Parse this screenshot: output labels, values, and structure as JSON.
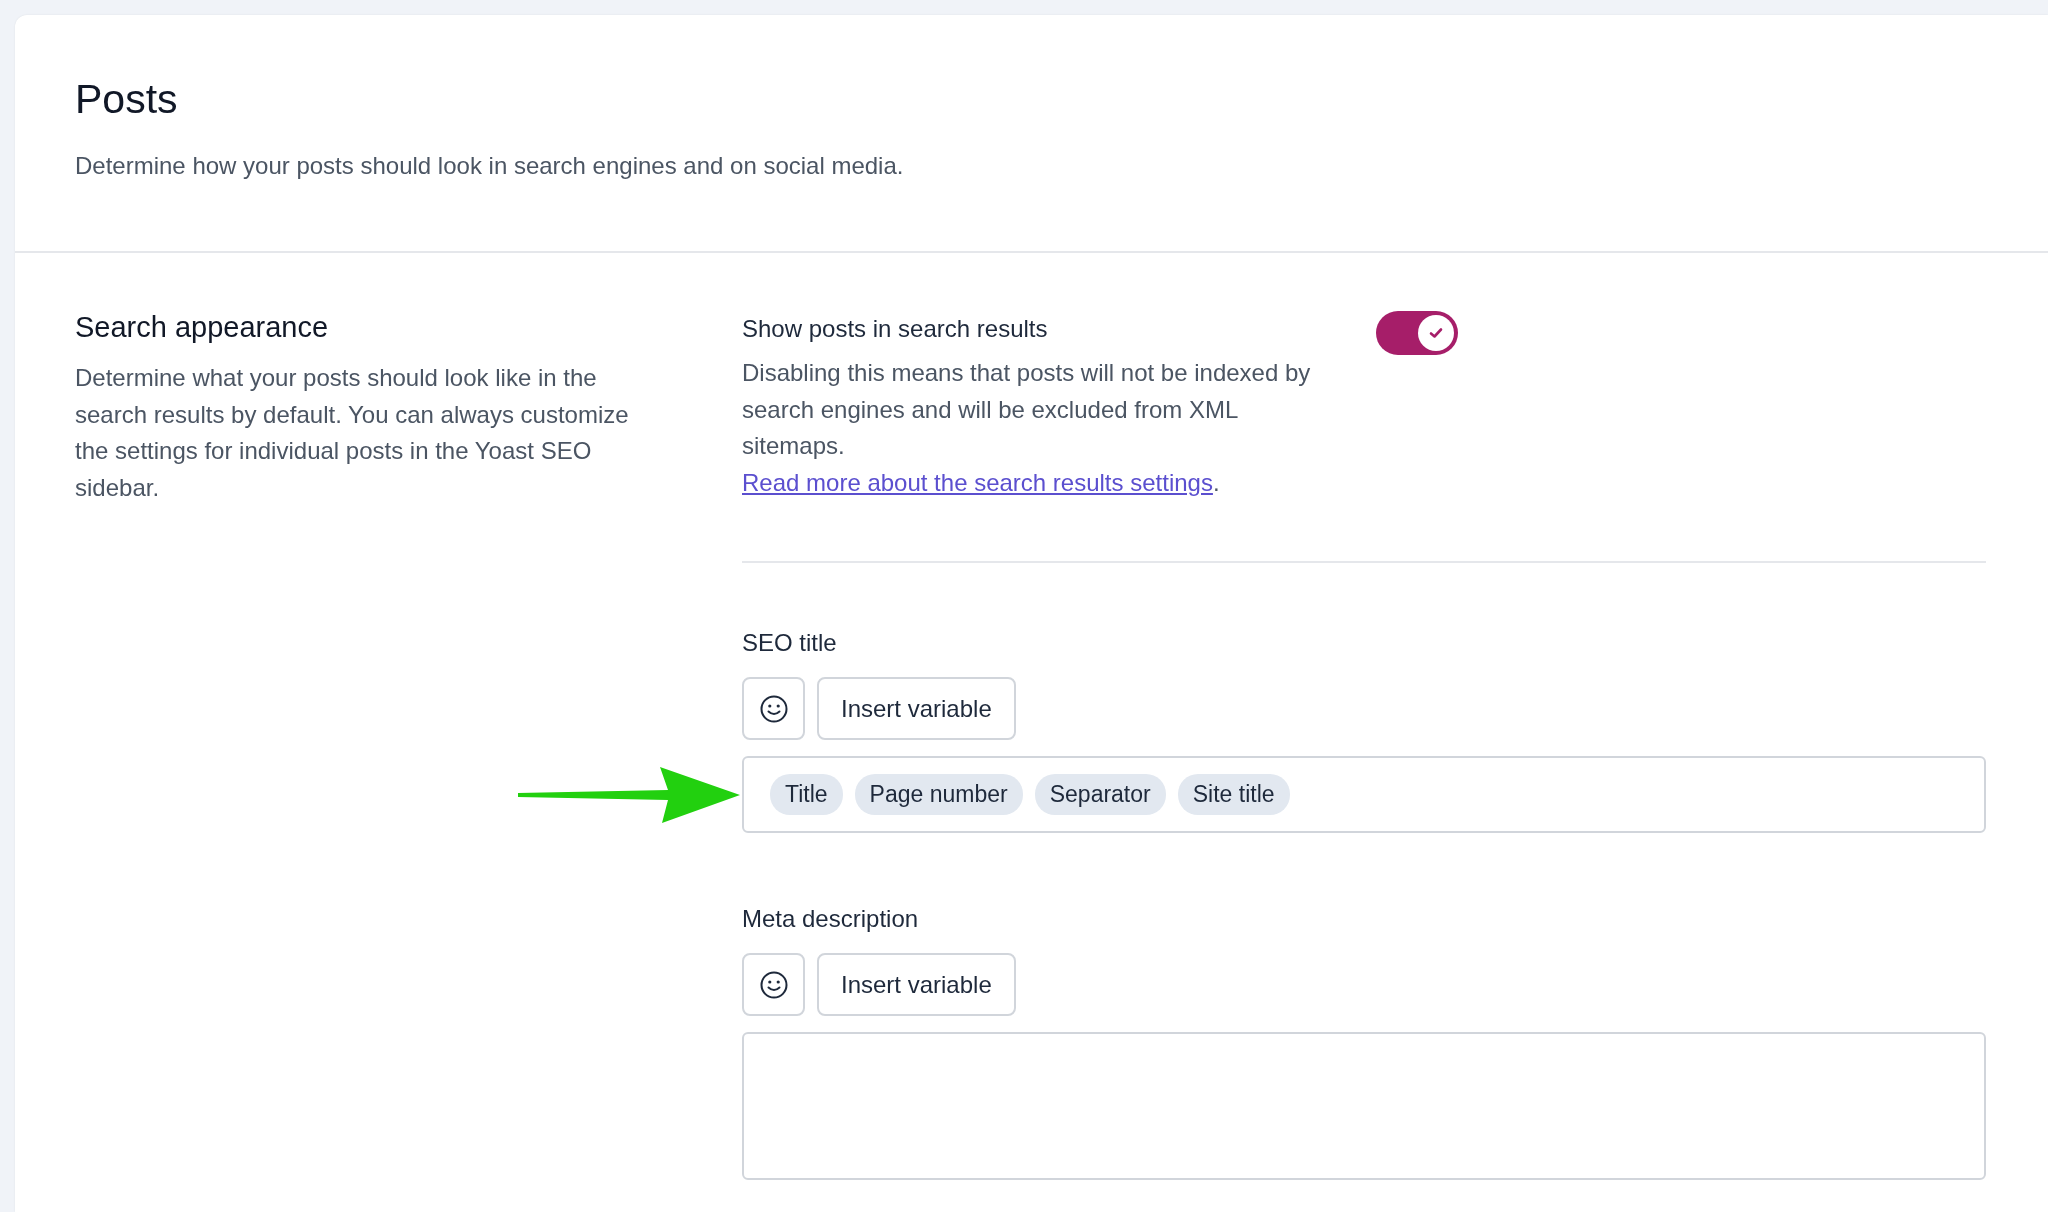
{
  "page": {
    "title": "Posts",
    "description": "Determine how your posts should look in search engines and on social media."
  },
  "section": {
    "title": "Search appearance",
    "description": "Determine what your posts should look like in the search results by default. You can always customize the settings for individual posts in the Yoast SEO sidebar."
  },
  "toggle_setting": {
    "label": "Show posts in search results",
    "on": true,
    "description": "Disabling this means that posts will not be indexed by search engines and will be excluded from XML sitemaps. ",
    "link": "Read more about the search results settings",
    "after_link": "."
  },
  "fields": [
    {
      "label": "SEO title",
      "kind": "single",
      "insert_button": "Insert variable",
      "chips": [
        "Title",
        "Page number",
        "Separator",
        "Site title"
      ]
    },
    {
      "label": "Meta description",
      "kind": "multi",
      "insert_button": "Insert variable"
    }
  ]
}
